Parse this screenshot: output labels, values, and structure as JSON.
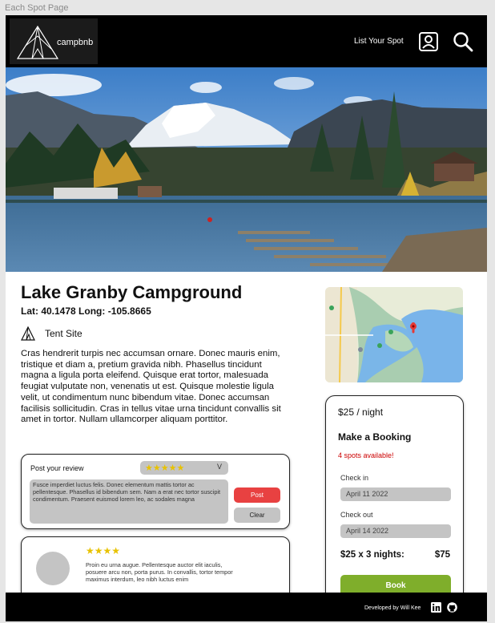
{
  "frame": {
    "label": "Each Spot Page"
  },
  "header": {
    "logo_text": "campbnb",
    "list_spot_label": "List Your Spot",
    "icons": [
      "user-icon",
      "search-icon"
    ],
    "background": "#000000"
  },
  "spot": {
    "title": "Lake Granby Campground",
    "coordinates": "Lat: 40.1478 Long: -105.8665",
    "site_type": "Tent Site",
    "description": "Cras hendrerit turpis nec accumsan ornare. Donec mauris enim, tristique et diam a, pretium gravida nibh. Phasellus tincidunt magna a ligula porta eleifend. Quisque erat tortor, malesuada feugiat vulputate non, venenatis ut est. Quisque molestie ligula velit, ut condimentum nunc bibendum vitae. Donec accumsan facilisis sollicitudin. Cras in tellus vitae urna tincidunt convallis sit amet in tortor. Nullam ullamcorper aliquam porttitor."
  },
  "booking": {
    "price": "$25 / night",
    "title": "Make a Booking",
    "availability": "4 spots available!",
    "check_in_label": "Check in",
    "check_in_value": "April 11 2022",
    "check_out_label": "Check out",
    "check_out_value": "April 14 2022",
    "summary": "$25 x 3 nights:",
    "total": "$75",
    "book_label": "Book",
    "book_color": "#7fae2b",
    "availability_color": "#cc0000"
  },
  "review_form": {
    "label": "Post your review",
    "rating_stars": "★★★★★",
    "dropdown_indicator": "V",
    "text": "Fusce imperdiet luctus felis. Donec elementum mattis tortor ac pellentesque. Phasellus id bibendum sem. Nam a erat nec tortor suscipit condimentum. Praesent euismod lorem leo, ac sodales magna",
    "post_label": "Post",
    "clear_label": "Clear",
    "post_color": "#e84141"
  },
  "reviews": [
    {
      "stars": "★★★★",
      "text": "Proin eu urna augue. Pellentesque auctor elit iaculis, posuere arcu non, porta purus. In convallis, tortor tempor maximus interdum, leo nibh luctus enim"
    }
  ],
  "footer": {
    "credit": "Developed by Will Kee",
    "icons": [
      "linkedin-icon",
      "github-icon"
    ]
  }
}
